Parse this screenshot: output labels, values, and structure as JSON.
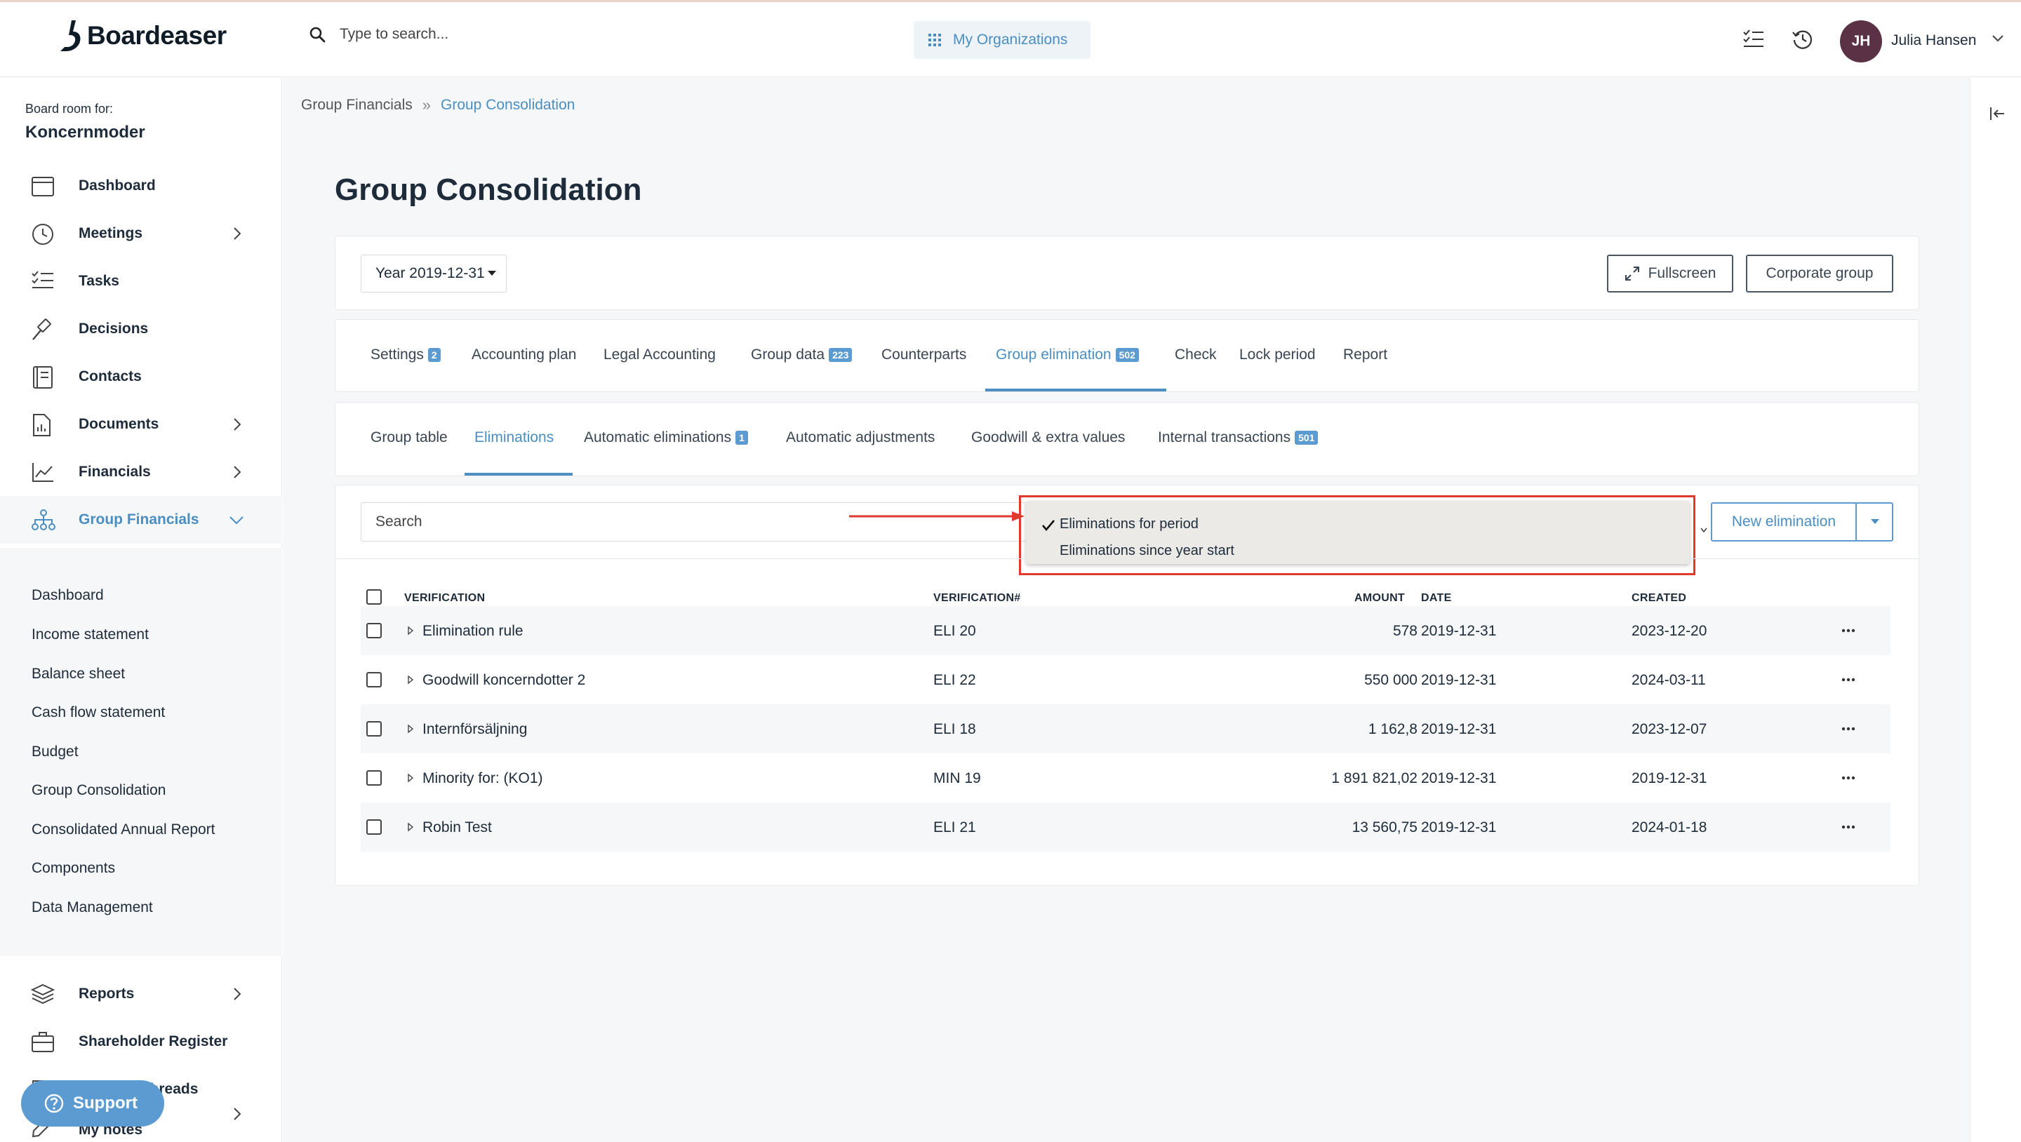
{
  "header": {
    "logo_text": "Boardeaser",
    "search_placeholder": "Type to search...",
    "my_orgs_label": "My Organizations",
    "user_initials": "JH",
    "user_name": "Julia Hansen"
  },
  "sidebar": {
    "board_label": "Board room for:",
    "board_name": "Koncernmoder",
    "items": [
      {
        "label": "Dashboard",
        "icon": "calendar-icon"
      },
      {
        "label": "Meetings",
        "icon": "clock-icon"
      },
      {
        "label": "Tasks",
        "icon": "task-list-icon"
      },
      {
        "label": "Decisions",
        "icon": "gavel-icon"
      },
      {
        "label": "Contacts",
        "icon": "address-book-icon"
      },
      {
        "label": "Documents",
        "icon": "document-icon"
      },
      {
        "label": "Financials",
        "icon": "line-chart-icon"
      },
      {
        "label": "Group Financials",
        "icon": "org-chart-icon"
      }
    ],
    "group_sub_items": [
      "Dashboard",
      "Income statement",
      "Balance sheet",
      "Cash flow statement",
      "Budget",
      "Group Consolidation",
      "Consolidated Annual Report",
      "Components",
      "Data Management"
    ],
    "bottom_items": [
      {
        "label": "Reports",
        "icon": "layers-icon"
      },
      {
        "label": "Shareholder Register",
        "icon": "briefcase-icon"
      },
      {
        "label": "Message threads",
        "icon": "chat-icon"
      },
      {
        "label": "My notes",
        "icon": "pencil-icon"
      }
    ],
    "support_label": "Support"
  },
  "breadcrumb": {
    "parent": "Group Financials",
    "separator": "»",
    "current": "Group Consolidation"
  },
  "page_title": "Group Consolidation",
  "toolbar": {
    "year_select": "Year 2019-12-31",
    "fullscreen_label": "Fullscreen",
    "corporate_group_label": "Corporate group"
  },
  "main_tabs": [
    {
      "label": "Settings",
      "badge": "2"
    },
    {
      "label": "Accounting plan",
      "badge": ""
    },
    {
      "label": "Legal Accounting",
      "badge": ""
    },
    {
      "label": "Group data",
      "badge": "223"
    },
    {
      "label": "Counterparts",
      "badge": ""
    },
    {
      "label": "Group elimination",
      "badge": "502"
    },
    {
      "label": "Check",
      "badge": ""
    },
    {
      "label": "Lock period",
      "badge": ""
    },
    {
      "label": "Report",
      "badge": ""
    }
  ],
  "sub_tabs": [
    {
      "label": "Group table",
      "badge": ""
    },
    {
      "label": "Eliminations",
      "badge": ""
    },
    {
      "label": "Automatic eliminations",
      "badge": "1"
    },
    {
      "label": "Automatic adjustments",
      "badge": ""
    },
    {
      "label": "Goodwill & extra values",
      "badge": ""
    },
    {
      "label": "Internal transactions",
      "badge": "501"
    }
  ],
  "filter": {
    "search_placeholder": "Search",
    "dropdown_options": [
      "Eliminations for period",
      "Eliminations since year start"
    ],
    "selected_option": "Eliminations for period",
    "new_elimination_label": "New elimination"
  },
  "table": {
    "columns": [
      "VERIFICATION",
      "VERIFICATION#",
      "AMOUNT",
      "DATE",
      "CREATED"
    ],
    "rows": [
      {
        "verification": "Elimination rule",
        "number": "ELI 20",
        "amount": "578",
        "date": "2019-12-31",
        "created": "2023-12-20"
      },
      {
        "verification": "Goodwill koncerndotter 2",
        "number": "ELI 22",
        "amount": "550 000",
        "date": "2019-12-31",
        "created": "2024-03-11"
      },
      {
        "verification": "Internförsäljning",
        "number": "ELI 18",
        "amount": "1 162,8",
        "date": "2019-12-31",
        "created": "2023-12-07"
      },
      {
        "verification": "Minority for: (KO1)",
        "number": "MIN 19",
        "amount": "1 891 821,02",
        "date": "2019-12-31",
        "created": "2019-12-31"
      },
      {
        "verification": "Robin Test",
        "number": "ELI 21",
        "amount": "13 560,75",
        "date": "2019-12-31",
        "created": "2024-01-18"
      }
    ]
  },
  "colors": {
    "accent": "#4a8ec2",
    "badge": "#5b9bd1",
    "highlight_border": "#e03a2e",
    "avatar_bg": "#5b3245"
  }
}
